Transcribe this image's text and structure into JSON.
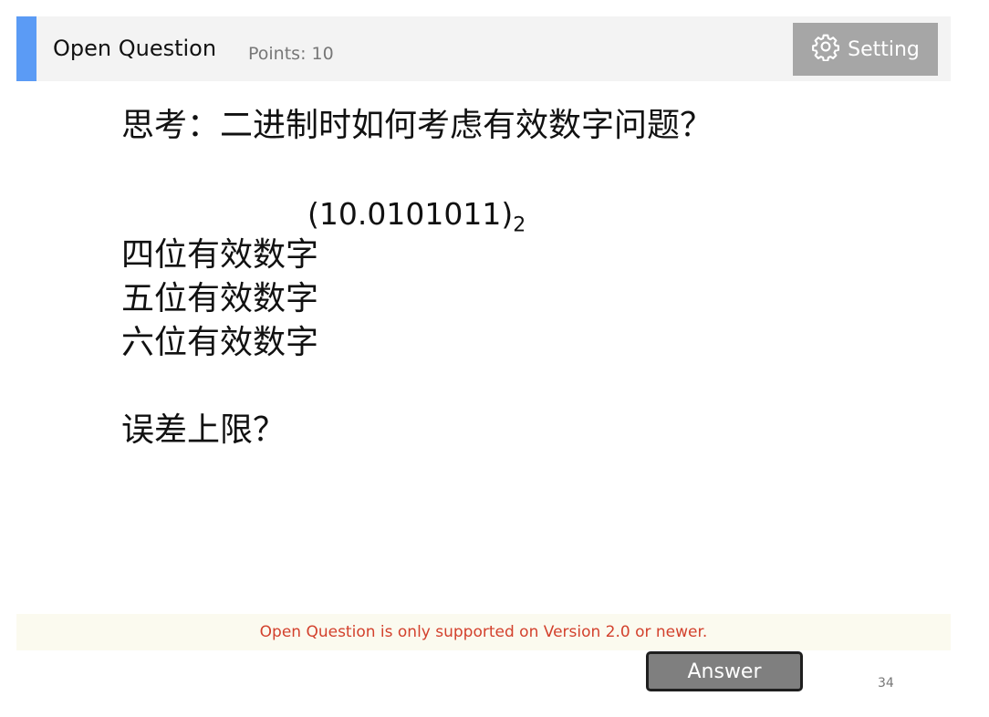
{
  "header": {
    "title": "Open Question",
    "points": "Points: 10",
    "setting_label": "Setting",
    "accent_color": "#5b9bf5",
    "setting_icon": "gear-icon"
  },
  "slide": {
    "question": "思考：二进制时如何考虑有效数字问题？",
    "binary_value": "(10.0101011)",
    "binary_base": "2",
    "options": [
      "四位有效数字",
      "五位有效数字",
      "六位有效数字"
    ],
    "error_question": "误差上限？"
  },
  "notice": {
    "text": "Open Question is only supported on Version 2.0 or newer.",
    "color": "#d3412d"
  },
  "answer_label": "Answer",
  "page_number": "34"
}
